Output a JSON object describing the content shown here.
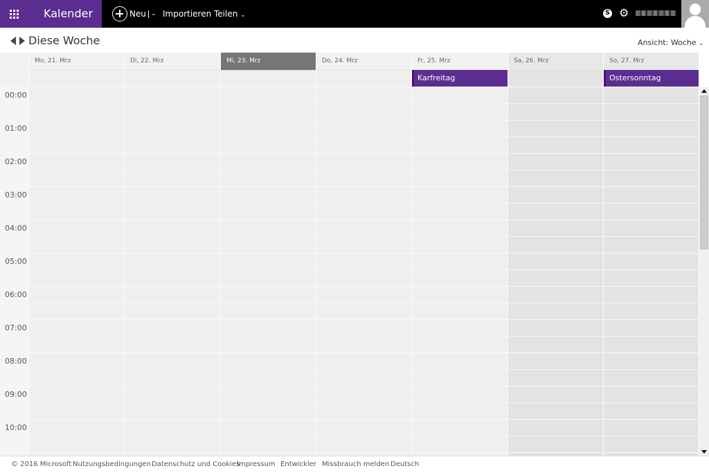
{
  "topbar": {
    "app_name": "Kalender",
    "new_label": "Neu",
    "import_label": "Importieren",
    "share_label": "Teilen",
    "icons": [
      "waffle-icon",
      "plus-circle-icon",
      "skype-icon",
      "gear-icon",
      "avatar-icon"
    ],
    "brand_color": "#5c2d91"
  },
  "header": {
    "title": "Diese Woche",
    "view_label": "Ansicht: Woche"
  },
  "days": [
    {
      "label": "Mo, 21. Mrz",
      "today": false,
      "weekend": false
    },
    {
      "label": "Di, 22. Mrz",
      "today": false,
      "weekend": false
    },
    {
      "label": "Mi, 23. Mrz",
      "today": true,
      "weekend": false
    },
    {
      "label": "Do, 24. Mrz",
      "today": false,
      "weekend": false
    },
    {
      "label": "Fr, 25. Mrz",
      "today": false,
      "weekend": false
    },
    {
      "label": "Sa, 26. Mrz",
      "today": false,
      "weekend": true
    },
    {
      "label": "So, 27. Mrz",
      "today": false,
      "weekend": true
    }
  ],
  "allday_events": [
    {
      "title": "Karfreitag",
      "day": "Fr, 25. Mrz"
    },
    {
      "title": "Ostersonntag",
      "day": "So, 27. Mrz"
    }
  ],
  "hours": [
    "00:00",
    "01:00",
    "02:00",
    "03:00",
    "04:00",
    "05:00",
    "06:00",
    "07:00",
    "08:00",
    "09:00",
    "10:00"
  ],
  "footer": {
    "copyright": "© 2016 Microsoft",
    "links": [
      "Nutzungsbedingungen",
      "Datenschutz und Cookies",
      "Impressum",
      "Entwickler",
      "Missbrauch melden",
      "Deutsch"
    ]
  }
}
